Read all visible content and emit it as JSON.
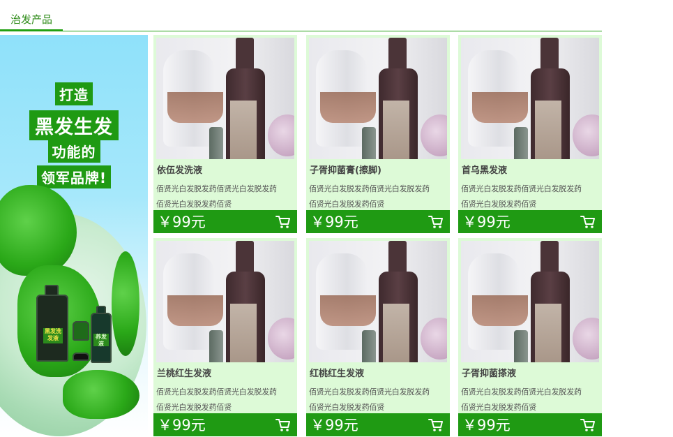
{
  "header": {
    "tab_label": "治发产品"
  },
  "banner": {
    "slogan": [
      "打造",
      "黑发生发",
      "功能的",
      "领军品牌!"
    ],
    "bottle_text": [
      "黑发洗发液",
      "养发液"
    ]
  },
  "products": [
    {
      "name": "依伍发洗液",
      "desc_1": "佰贤光白发脱发药佰贤光白发脱发药",
      "desc_2": "佰贤光白发脱发药佰贤",
      "price": "￥99元"
    },
    {
      "name": "子胥抑菌膏(擦脚)",
      "desc_1": "佰贤光白发脱发药佰贤光白发脱发药",
      "desc_2": "佰贤光白发脱发药佰贤",
      "price": "￥99元"
    },
    {
      "name": "首乌黑发液",
      "desc_1": "佰贤光白发脱发药佰贤光白发脱发药",
      "desc_2": "佰贤光白发脱发药佰贤",
      "price": "￥99元"
    },
    {
      "name": "兰桃红生发液",
      "desc_1": "佰贤光白发脱发药佰贤光白发脱发药",
      "desc_2": "佰贤光白发脱发药佰贤",
      "price": "￥99元"
    },
    {
      "name": "红桃红生发液",
      "desc_1": "佰贤光白发脱发药佰贤光白发脱发药",
      "desc_2": "佰贤光白发脱发药佰贤",
      "price": "￥99元"
    },
    {
      "name": "子胥抑菌搽液",
      "desc_1": "佰贤光白发脱发药佰贤光白发脱发药",
      "desc_2": "佰贤光白发脱发药佰贤",
      "price": "￥99元"
    }
  ],
  "icons": {
    "cart": "shopping-cart-icon"
  },
  "colors": {
    "accent": "#1f9a13",
    "card_bg": "#ddfad7",
    "banner_sky": "#8fe1fa"
  }
}
